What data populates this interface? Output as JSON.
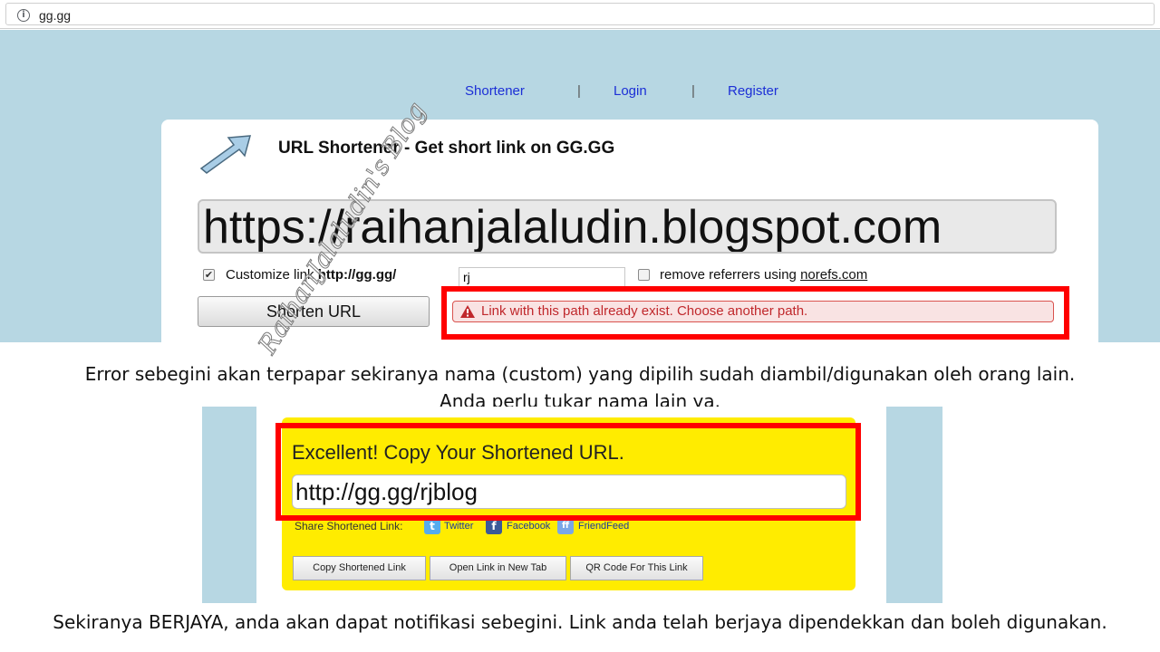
{
  "browser": {
    "address": "gg.gg",
    "info_icon": "i"
  },
  "nav": {
    "items": [
      "Shortener",
      "Login",
      "Register"
    ],
    "separator": "|"
  },
  "shortener": {
    "title": "URL Shortener - Get short link on GG.GG",
    "icon": "arrow-icon",
    "url_value": "https://raihanjalaludin.blogspot.com",
    "customize_label": "Customize link",
    "customize_prefix": "http://gg.gg/",
    "customize_value": "rj",
    "customize_checked": true,
    "referrer_label": "remove referrers using",
    "referrer_link": "norefs.com",
    "referrer_checked": false,
    "shorten_button": "Shorten URL",
    "error_message": "Link with this path already exist. Choose another path."
  },
  "captions": {
    "error_line1": "Error sebegini akan terpapar sekiranya nama (custom) yang dipilih sudah diambil/digunakan oleh orang lain.",
    "error_line2": "Anda perlu tukar nama lain ya.",
    "success": "Sekiranya BERJAYA, anda akan dapat notifikasi sebegini. Link anda telah berjaya dipendekkan dan boleh digunakan."
  },
  "result": {
    "title": "Excellent! Copy Your Shortened URL.",
    "short_url": "http://gg.gg/rjblog",
    "share_label": "Share Shortened Link:",
    "share": [
      {
        "label": "Twitter",
        "icon": "twitter-icon",
        "color": "#55acee",
        "glyph": "t"
      },
      {
        "label": "Facebook",
        "icon": "facebook-icon",
        "color": "#3b5998",
        "glyph": "f"
      },
      {
        "label": "FriendFeed",
        "icon": "friendfeed-icon",
        "color": "#7aa7e8",
        "glyph": "ff"
      }
    ],
    "buttons": [
      "Copy Shortened Link",
      "Open Link in New Tab",
      "QR Code For This Link"
    ]
  },
  "watermark": "RaihanJalaludin's Blog",
  "colors": {
    "highlight": "#ff0000",
    "site_bg": "#b7d7e3",
    "result_bg": "#ffec00",
    "nav_link": "#1c2fd6",
    "error_text": "#c0282c"
  }
}
